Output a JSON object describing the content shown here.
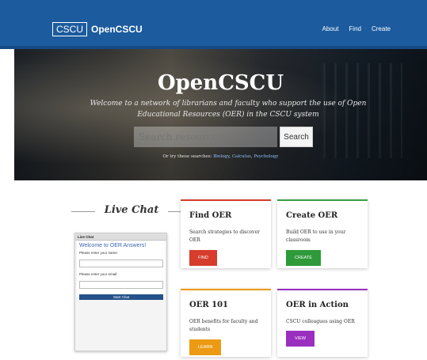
{
  "header": {
    "logo_box": "CSCU",
    "logo_text": "OpenCSCU",
    "nav": [
      "About",
      "Find",
      "Create"
    ]
  },
  "hero": {
    "title": "OpenCSCU",
    "subtitle": "Welcome to a network of librarians and faculty who support the use of Open Educational Resources (OER) in the CSCU system",
    "search_placeholder": "Search resources",
    "search_button": "Search",
    "try_prefix": "Or try these searches:",
    "try_links": [
      "Biology",
      "Calculus",
      "Psychology"
    ]
  },
  "chat": {
    "heading": "Live Chat",
    "bar_title": "Live Chat",
    "welcome": "Welcome to OER Answers!",
    "name_label": "Please enter your name:",
    "email_label": "Please enter your email:",
    "start_button": "Start Chat"
  },
  "cards": [
    {
      "title": "Find OER",
      "text": "Search strategies to discover OER",
      "button": "FIND",
      "color": "#d63d2c"
    },
    {
      "title": "Create OER",
      "text": "Build OER to use in your classroom",
      "button": "CREATE",
      "color": "#39a143"
    },
    {
      "title": "OER 101",
      "text": "OER benefits for faculty and students",
      "button": "LEARN",
      "color": "#ec9a13"
    },
    {
      "title": "OER in Action",
      "text": "CSCU colleagues using OER",
      "button": "VIEW",
      "color": "#9a2fbf"
    }
  ],
  "colors": {
    "header_bg": "#1c5b9e",
    "link": "#8fc3ff"
  }
}
